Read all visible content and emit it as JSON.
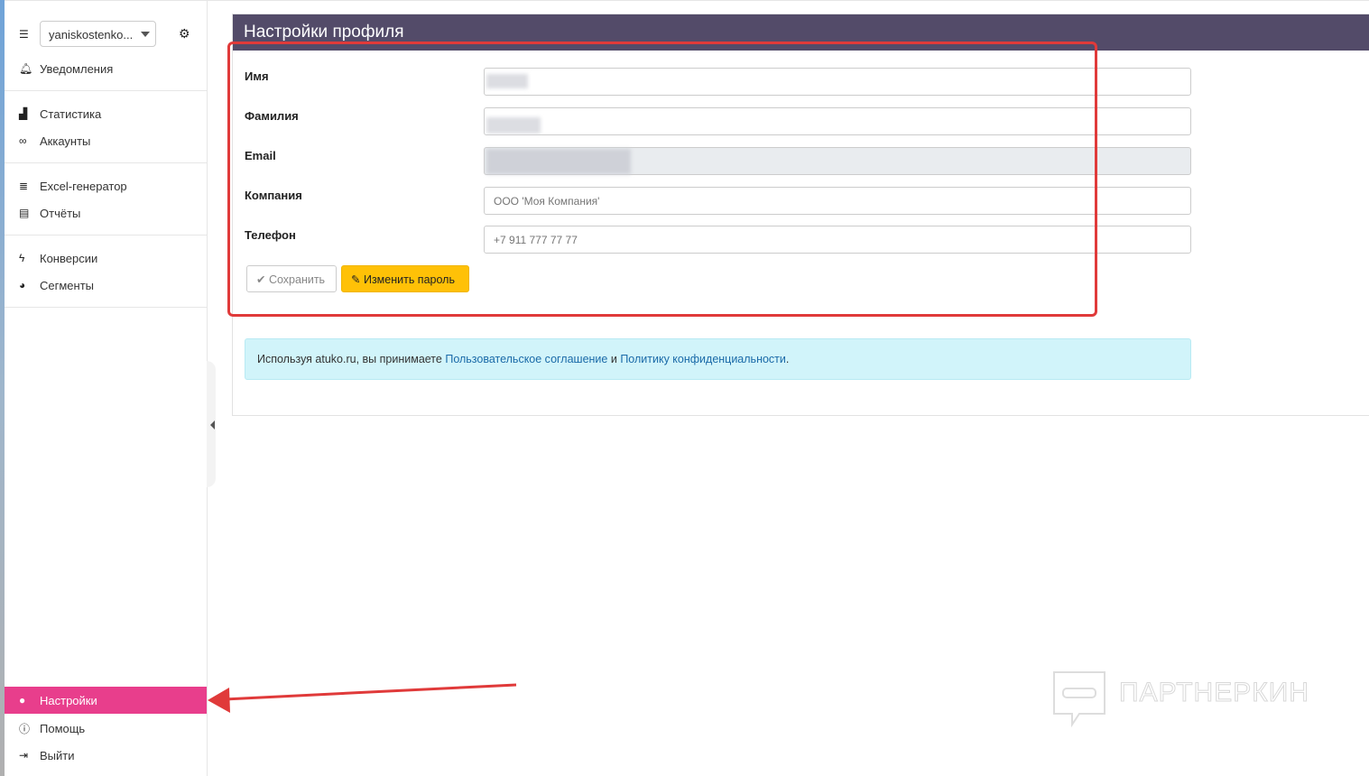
{
  "sidebar": {
    "account": "yaniskostenko...",
    "items": [
      {
        "label": "Уведомления",
        "icon": "bell-icon"
      },
      {
        "label": "Статистика",
        "icon": "bar-chart-icon"
      },
      {
        "label": "Аккаунты",
        "icon": "link-icon"
      },
      {
        "label": "Excel-генератор",
        "icon": "list-icon"
      },
      {
        "label": "Отчёты",
        "icon": "calendar-icon"
      },
      {
        "label": "Конверсии",
        "icon": "bolt-icon"
      },
      {
        "label": "Сегменты",
        "icon": "pie-chart-icon"
      },
      {
        "label": "Настройки",
        "icon": "user-icon",
        "active": true
      },
      {
        "label": "Помощь",
        "icon": "info-icon"
      },
      {
        "label": "Выйти",
        "icon": "logout-icon"
      }
    ]
  },
  "panel": {
    "title": "Настройки профиля",
    "fields": [
      {
        "label": "Имя",
        "value": "",
        "placeholder": ""
      },
      {
        "label": "Фамилия",
        "value": "",
        "placeholder": ""
      },
      {
        "label": "Email",
        "value": "",
        "placeholder": "",
        "disabled": true
      },
      {
        "label": "Компания",
        "value": "",
        "placeholder": "ООО 'Моя Компания'"
      },
      {
        "label": "Телефон",
        "value": "",
        "placeholder": "+7 911 777 77 77"
      }
    ],
    "save_label": "Сохранить",
    "change_password_label": "Изменить пароль",
    "notice": {
      "prefix": "Используя atuko.ru, вы принимаете ",
      "link1": "Пользовательское соглашение",
      "mid": " и ",
      "link2": "Политику конфиденциальности",
      "suffix": "."
    }
  },
  "watermark": "ПАРТНЕРКИН",
  "colors": {
    "header": "#534b69",
    "active": "#e83e8c",
    "warning": "#ffc107",
    "annotation": "#e03a3a"
  }
}
